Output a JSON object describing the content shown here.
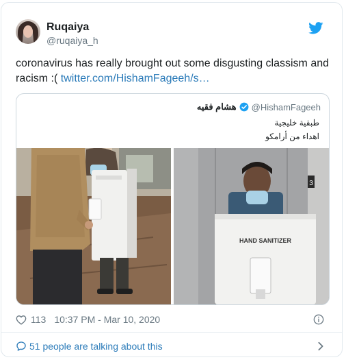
{
  "author": {
    "name": "Ruqaiya",
    "handle": "@ruqaiya_h"
  },
  "icons": {
    "brand": "twitter-bird-icon",
    "like": "heart-icon",
    "info": "info-icon",
    "conversation": "speech-bubble-icon",
    "more": "chevron-right-icon",
    "verified": "verified-badge-icon"
  },
  "colors": {
    "link": "#2b7bb9",
    "twitter_blue": "#1da1f2",
    "secondary_text": "#697882",
    "border": "#e1e8ed"
  },
  "tweet": {
    "text": "coronavirus has really brought out some disgusting classism and racism :( ",
    "link_text": "twitter.com/HishamFageeh/s…"
  },
  "quoted": {
    "name": "هشام فقيه",
    "handle": "@HishamFageeh",
    "line1": "طبقية خليجية",
    "line2": "اهداء من أرامكو",
    "photo_right_sign": "HAND SANITIZER",
    "photo_right_floor": "3"
  },
  "footer": {
    "like_count": "113",
    "timestamp": "10:37 PM - Mar 10, 2020",
    "conversation_label": "51 people are talking about this"
  }
}
